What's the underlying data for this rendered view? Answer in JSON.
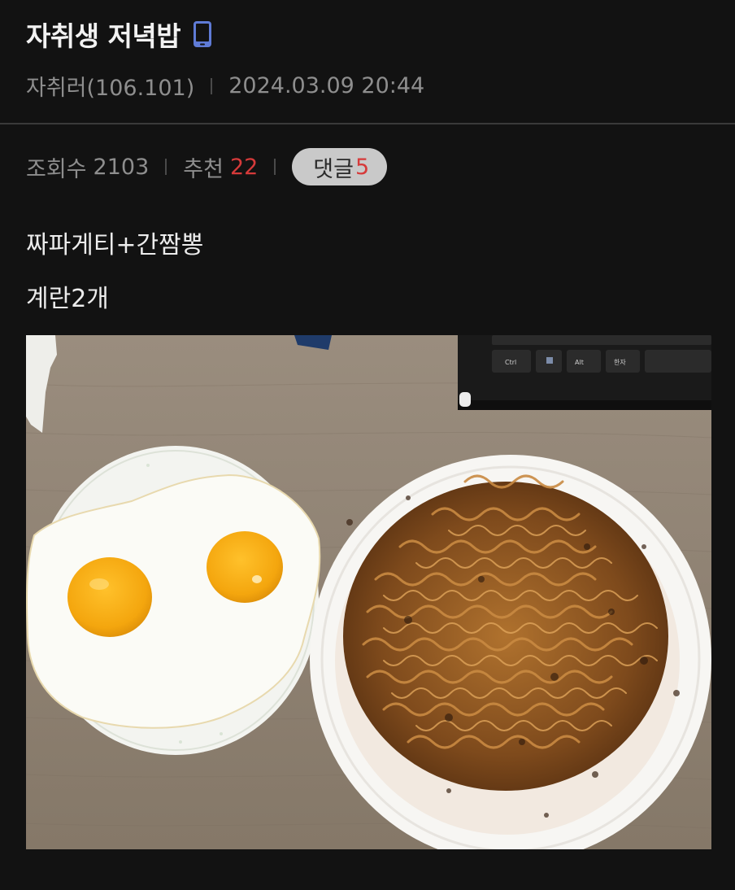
{
  "post": {
    "title": "자취생 저녁밥",
    "author": "자취러(106.101)",
    "datetime": "2024.03.09 20:44",
    "views_label": "조회수",
    "views": "2103",
    "recommend_label": "추천",
    "recommend": "22",
    "comments_label": "댓글",
    "comments": "5",
    "lines": [
      "짜파게티+간짬뽕",
      "계란2개"
    ]
  },
  "image": {
    "subject": "photo",
    "keyboard_keys": [
      "Ctrl",
      "Alt",
      "한자"
    ]
  },
  "colors": {
    "background": "#121212",
    "accent_red": "#d63a3a",
    "muted_text": "#8e8e8e",
    "pill_bg": "#c9c9c9"
  },
  "icons": {
    "mobile": "mobile-phone-icon"
  }
}
